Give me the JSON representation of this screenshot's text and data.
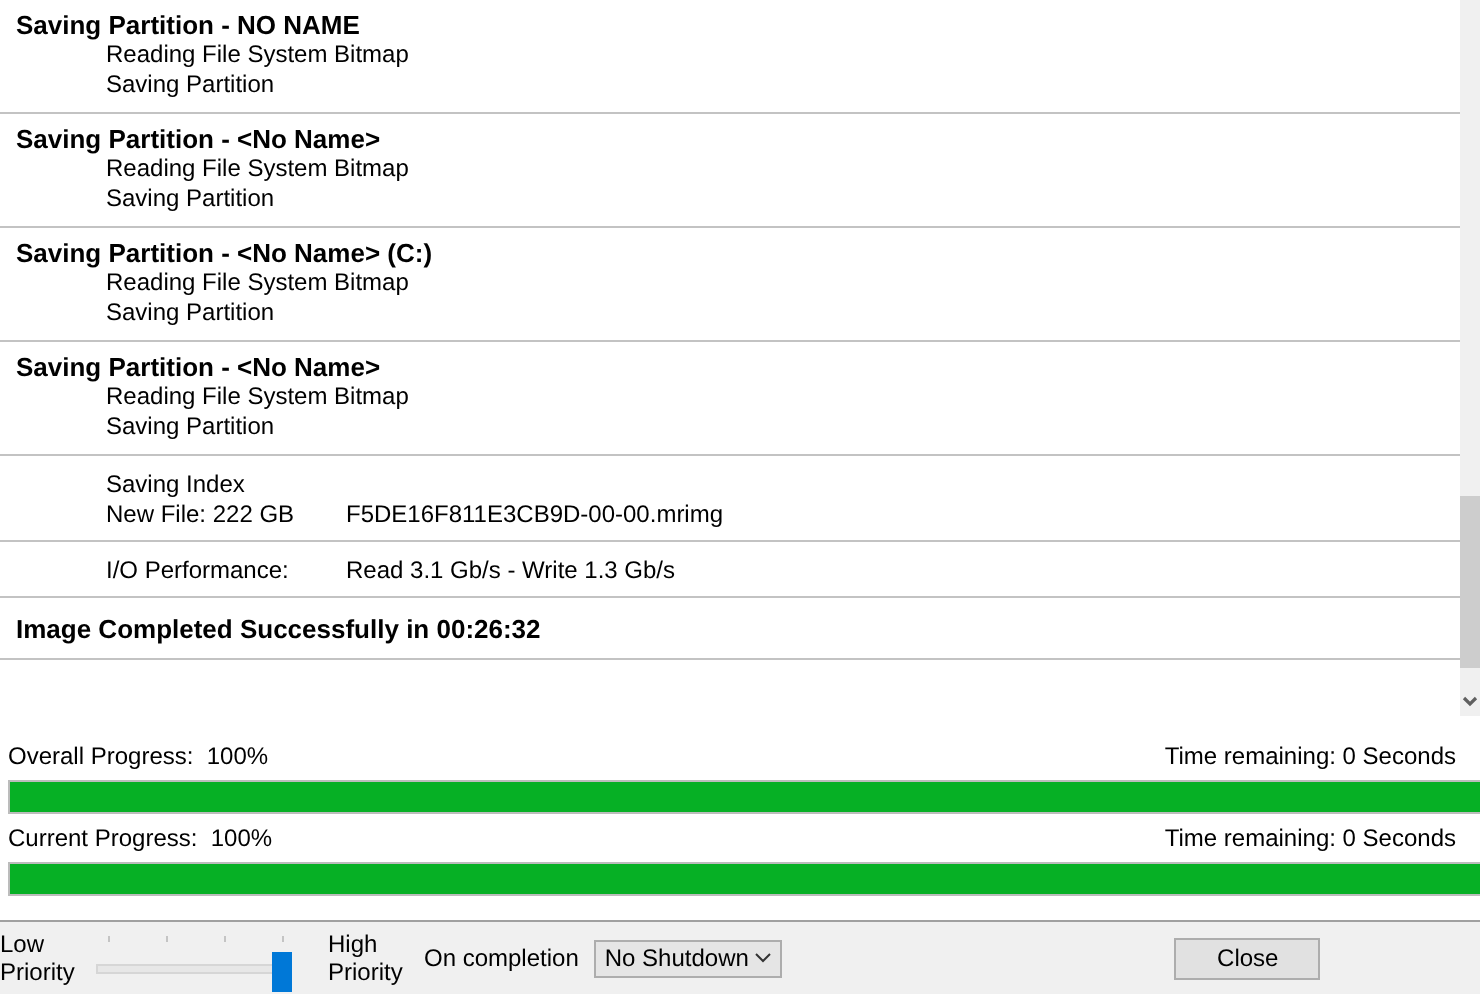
{
  "log": [
    {
      "kind": "step",
      "title": "Saving Partition - NO NAME",
      "lines": [
        "Reading File System Bitmap",
        "Saving Partition"
      ]
    },
    {
      "kind": "step",
      "title": "Saving Partition - <No Name>",
      "lines": [
        "Reading File System Bitmap",
        "Saving Partition"
      ]
    },
    {
      "kind": "step",
      "title": "Saving Partition - <No Name> (C:)",
      "lines": [
        "Reading File System Bitmap",
        "Saving Partition"
      ]
    },
    {
      "kind": "step",
      "title": "Saving Partition - <No Name>",
      "lines": [
        "Reading File System Bitmap",
        "Saving Partition"
      ]
    },
    {
      "kind": "detail",
      "rows": [
        {
          "label": "Saving Index"
        },
        {
          "label": "New File: 222 GB",
          "value": "F5DE16F811E3CB9D-00-00.mrimg"
        }
      ]
    },
    {
      "kind": "detail",
      "rows": [
        {
          "label": "I/O Performance:",
          "value": "Read 3.1 Gb/s - Write 1.3 Gb/s"
        }
      ]
    },
    {
      "kind": "summary",
      "text": "Image Completed Successfully in 00:26:32"
    }
  ],
  "progress": [
    {
      "label": "Overall Progress:",
      "percent": "100%",
      "remaining": "Time remaining: 0 Seconds",
      "level": 1
    },
    {
      "label": "Current Progress:",
      "percent": "100%",
      "remaining": "Time remaining: 0 Seconds",
      "level": 1
    }
  ],
  "footer": {
    "low_label": "Low Priority",
    "high_label": "High Priority",
    "priority": {
      "level": 1
    },
    "completion_label": "On completion",
    "completion": {
      "value": "No Shutdown"
    },
    "close": "Close"
  }
}
